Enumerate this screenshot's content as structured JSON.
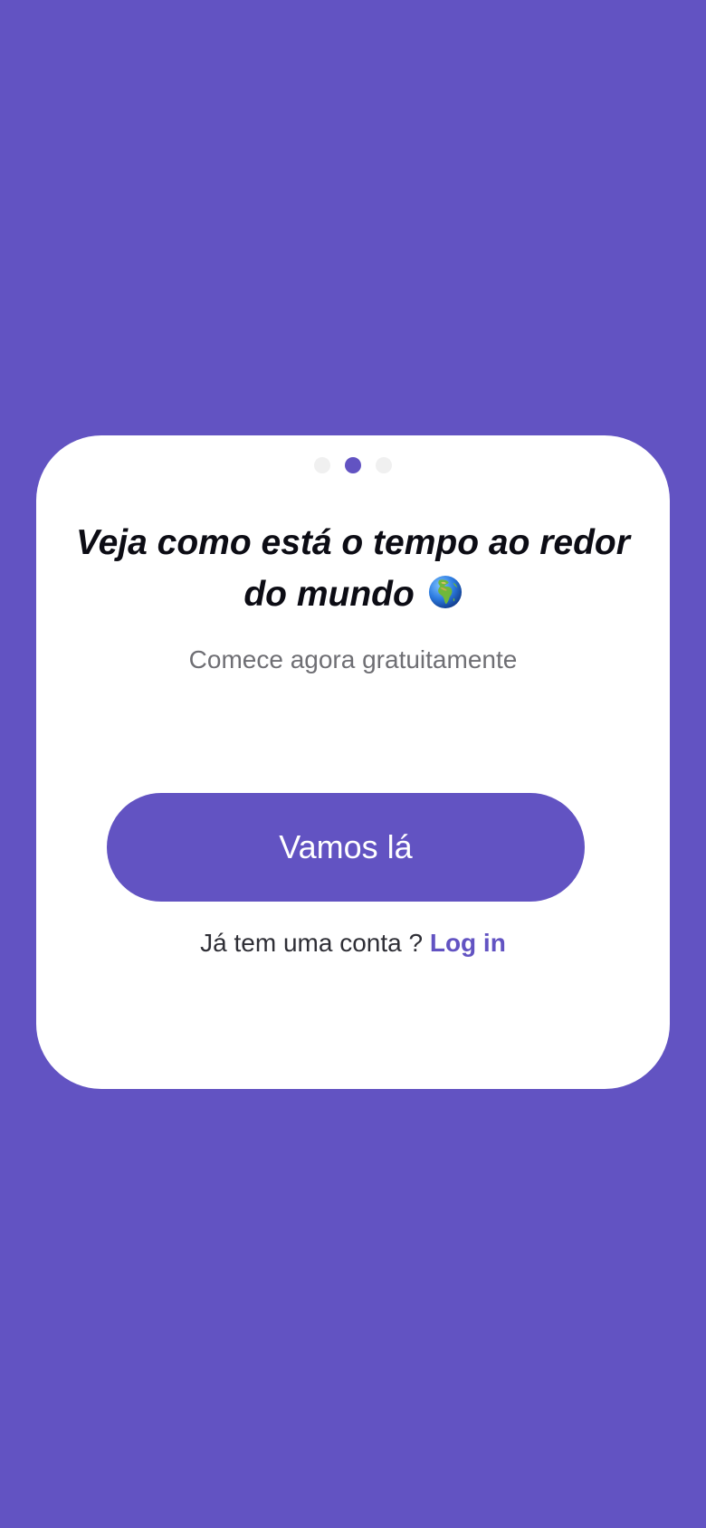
{
  "onboarding": {
    "title_text": "Veja como está o tempo ao redor do mundo",
    "title_emoji_icon": "globe-europe-africa-icon",
    "subtitle": "Comece agora gratuitamente",
    "cta_label": "Vamos lá",
    "account_prompt": "Já tem uma conta ?",
    "login_label": "Log in",
    "pagination": {
      "total": 3,
      "active_index": 1
    }
  },
  "colors": {
    "background": "#6253c2",
    "accent": "#6253c2",
    "card": "#ffffff",
    "dot_inactive": "#f0f0f0"
  }
}
